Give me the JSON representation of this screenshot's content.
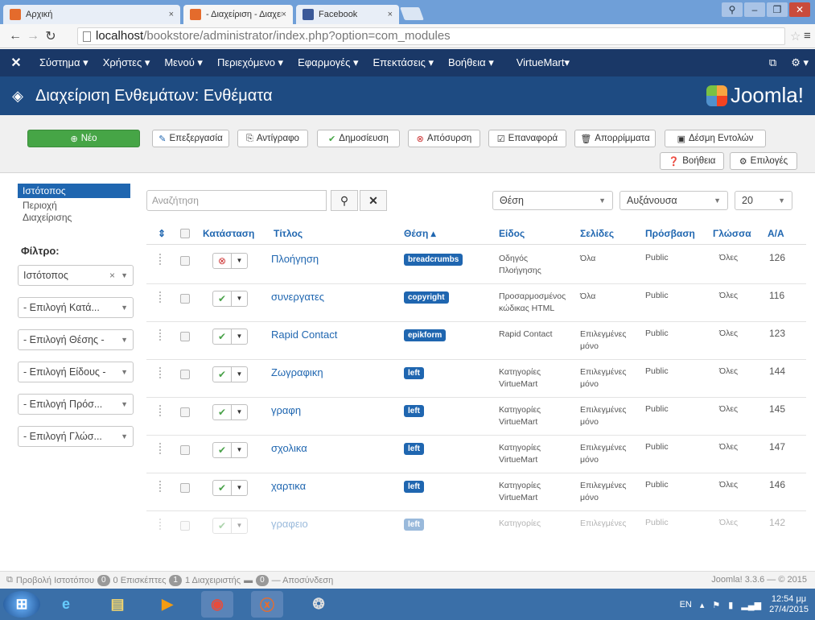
{
  "browser": {
    "tabs": [
      {
        "label": "Αρχική",
        "close": "×",
        "active": false,
        "favicon": "joomla-favicon"
      },
      {
        "label": "- Διαχείριση - Διαχείριση",
        "close": "×",
        "active": true,
        "favicon": "joomla-favicon"
      },
      {
        "label": "Facebook",
        "close": "×",
        "active": false,
        "favicon": "facebook-favicon"
      }
    ],
    "url_host": "localhost",
    "url_path": "/bookstore/administrator/index.php?option=com_modules"
  },
  "adminnav": {
    "logo": "joomla-logo",
    "items": [
      "Σύστημα ▾",
      "Χρήστες ▾",
      "Μενού ▾",
      "Περιεχόμενο ▾",
      "Εφαρμογές ▾",
      "Επεκτάσεις ▾",
      "Βοήθεια ▾",
      "VirtueMart▾"
    ],
    "right_icons": [
      "external-link-icon",
      "gear-icon"
    ]
  },
  "header": {
    "title": "Διαχείριση Ενθεμάτων: Ενθέματα",
    "brand": "Joomla!"
  },
  "toolbar": {
    "new": "Νέο",
    "edit": "Επεξεργασία",
    "copy": "Αντίγραφο",
    "publish": "Δημοσίευση",
    "unpublish": "Απόσυρση",
    "checkin": "Επαναφορά",
    "trash": "Απορρίμματα",
    "batch": "Δέσμη Εντολών",
    "help": "Βοήθεια",
    "options": "Επιλογές"
  },
  "sidebar": {
    "links": [
      "Ιστότοπος",
      "Περιοχή Διαχείρισης"
    ],
    "filter_title": "Φίλτρο:",
    "filters": [
      {
        "value": "Ιστότοπος",
        "clearable": true
      },
      {
        "value": "- Επιλογή Κατά..."
      },
      {
        "value": "- Επιλογή Θέσης -"
      },
      {
        "value": "- Επιλογή Είδους -"
      },
      {
        "value": "- Επιλογή Πρόσ..."
      },
      {
        "value": "- Επιλογή Γλώσ..."
      }
    ]
  },
  "search": {
    "placeholder": "Αναζήτηση",
    "position_select": "Θέση",
    "order_select": "Αυξάνουσα",
    "limit_select": "20"
  },
  "table": {
    "headers": {
      "sort": "⇕",
      "status": "Κατάσταση",
      "title": "Τίτλος",
      "position": "Θέση ▴",
      "type": "Είδος",
      "pages": "Σελίδες",
      "access": "Πρόσβαση",
      "language": "Γλώσσα",
      "id": "Α/Α"
    },
    "rows": [
      {
        "status": "unpublished",
        "title": "Πλοήγηση",
        "position": "breadcrumbs",
        "type": "Οδηγός Πλοήγησης",
        "pages": "Όλα",
        "access": "Public",
        "language": "Όλες",
        "id": "126"
      },
      {
        "status": "published",
        "title": "συνεργατες",
        "position": "copyright",
        "type": "Προσαρμοσμένος κώδικας HTML",
        "pages": "Όλα",
        "access": "Public",
        "language": "Όλες",
        "id": "116"
      },
      {
        "status": "published",
        "title": "Rapid Contact",
        "position": "epikform",
        "type": "Rapid Contact",
        "pages": "Επιλεγμένες μόνο",
        "access": "Public",
        "language": "Όλες",
        "id": "123"
      },
      {
        "status": "published",
        "title": "Ζωγραφικη",
        "position": "left",
        "type": "Κατηγορίες VirtueMart",
        "pages": "Επιλεγμένες μόνο",
        "access": "Public",
        "language": "Όλες",
        "id": "144"
      },
      {
        "status": "published",
        "title": "γραφη",
        "position": "left",
        "type": "Κατηγορίες VirtueMart",
        "pages": "Επιλεγμένες μόνο",
        "access": "Public",
        "language": "Όλες",
        "id": "145"
      },
      {
        "status": "published",
        "title": "σχολικα",
        "position": "left",
        "type": "Κατηγορίες VirtueMart",
        "pages": "Επιλεγμένες μόνο",
        "access": "Public",
        "language": "Όλες",
        "id": "147"
      },
      {
        "status": "published",
        "title": "χαρτικα",
        "position": "left",
        "type": "Κατηγορίες VirtueMart",
        "pages": "Επιλεγμένες μόνο",
        "access": "Public",
        "language": "Όλες",
        "id": "146"
      },
      {
        "status": "published",
        "title": "γραφειο",
        "position": "left",
        "type": "Κατηγορίες",
        "pages": "Επιλεγμένες",
        "access": "Public",
        "language": "Όλες",
        "id": "142"
      }
    ]
  },
  "statusbar": {
    "view_site": "Προβολή Ιστοτόπου",
    "visitors_count": "0",
    "visitors_label": "0 Επισκέπτες",
    "admins_count": "1",
    "admins_label": "1 Διαχειριστής",
    "messages_count": "0",
    "logout": "— Αποσύνδεση",
    "version": "Joomla! 3.3.6 — © 2015"
  },
  "taskbar": {
    "lang": "EN",
    "time": "12:54 μμ",
    "date": "27/4/2015"
  },
  "colors": {
    "admin_nav_bg": "#1a3867",
    "header_bg": "#1e4b82",
    "new_button": "#46a546",
    "link_blue": "#1f66b0"
  }
}
